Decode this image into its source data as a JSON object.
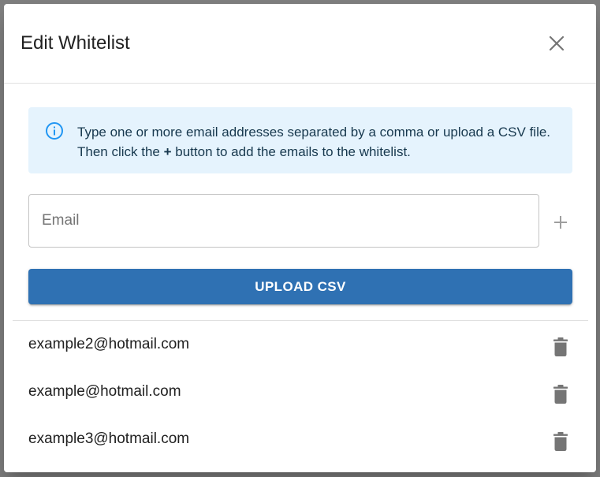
{
  "dialog": {
    "title": "Edit Whitelist",
    "close_icon": "close-icon"
  },
  "info": {
    "icon": "info-icon",
    "text_before": "Type one or more email addresses separated by a comma or upload a CSV file. Then click the ",
    "text_bold": "+",
    "text_after": " button to add the emails to the whitelist."
  },
  "email_input": {
    "placeholder": "Email",
    "value": ""
  },
  "add_button": {
    "icon": "plus-icon"
  },
  "upload_button": {
    "label": "UPLOAD CSV"
  },
  "whitelist": [
    {
      "email": "example2@hotmail.com",
      "icon": "trash-icon"
    },
    {
      "email": "example@hotmail.com",
      "icon": "trash-icon"
    },
    {
      "email": "example3@hotmail.com",
      "icon": "trash-icon"
    }
  ],
  "colors": {
    "primary": "#2f71b3",
    "info_bg": "#e5f3fd",
    "info_icon": "#2196f3",
    "icon_gray": "#757575",
    "backdrop": "#7f7f7f"
  }
}
